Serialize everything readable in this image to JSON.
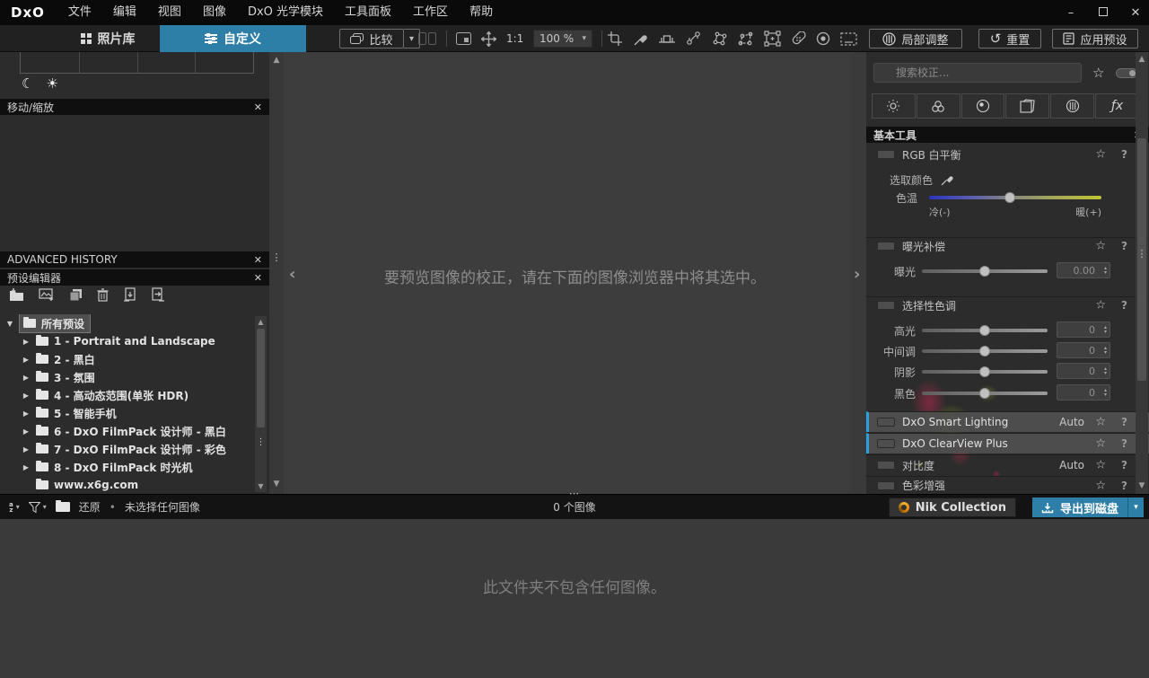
{
  "menubar": {
    "logo": "DxO",
    "items": [
      "文件",
      "编辑",
      "视图",
      "图像",
      "DxO 光学模块",
      "工具面板",
      "工作区",
      "帮助"
    ]
  },
  "toolbar": {
    "photo_library": "照片库",
    "customize": "自定义",
    "compare": "比较",
    "zoom_ratio": "1:1",
    "zoom_level": "100 %",
    "local_adjustments": "局部调整",
    "reset": "重置",
    "apply_preset": "应用预设"
  },
  "left_panel": {
    "move_zoom_title": "移动/缩放",
    "advanced_history_title": "ADVANCED HISTORY",
    "preset_editor_title": "预设编辑器",
    "tree": {
      "root": "所有预设",
      "items": [
        "1 - Portrait and Landscape",
        "2 - 黑白",
        "3 - 氛围",
        "4 - 高动态范围(单张 HDR)",
        "5 - 智能手机",
        "6 - DxO FilmPack 设计师 - 黑白",
        "7 - DxO FilmPack 设计师 - 彩色",
        "8 - DxO FilmPack 时光机",
        "www.x6g.com"
      ]
    }
  },
  "viewer": {
    "message": "要预览图像的校正，请在下面的图像浏览器中将其选中。"
  },
  "right_panel": {
    "search": {
      "placeholder": "搜索校正..."
    },
    "palette_title": "基本工具",
    "white_balance": {
      "label": "RGB 白平衡",
      "pick_color": "选取颜色",
      "temperature": "色温",
      "cold": "冷(-)",
      "warm": "暖(+)"
    },
    "exposure": {
      "label": "曝光补偿",
      "slider_label": "曝光",
      "value": "0.00"
    },
    "selective_tone": {
      "label": "选择性色调",
      "rows": [
        {
          "label": "高光",
          "value": "0"
        },
        {
          "label": "中间调",
          "value": "0"
        },
        {
          "label": "阴影",
          "value": "0"
        },
        {
          "label": "黑色",
          "value": "0"
        }
      ]
    },
    "tool_rows": [
      {
        "label": "DxO Smart Lighting",
        "mode": "Auto"
      },
      {
        "label": "DxO ClearView Plus",
        "mode": ""
      },
      {
        "label": "对比度",
        "mode": "Auto"
      },
      {
        "label": "色彩增强",
        "mode": ""
      }
    ],
    "fx_label": "ƒx"
  },
  "statusbar": {
    "restore": "还原",
    "separator": "•",
    "selection_status": "未选择任何图像",
    "image_count": "0 个图像",
    "nik_collection": "Nik Collection",
    "export_to_disk": "导出到磁盘"
  },
  "image_browser": {
    "empty_message": "此文件夹不包含任何图像。"
  },
  "icons": {
    "star": "☆",
    "help": "?",
    "close": "✕",
    "dropdown": "▾",
    "chevron_left": "‹",
    "chevron_right": "›",
    "tree_expanded": "▼",
    "tree_collapsed": "▶",
    "scroll_up": "▲",
    "scroll_down": "▼",
    "drag_dots": "⋮",
    "drag_ellipsis": "⋯",
    "moon": "☾",
    "sun": "☀",
    "reset_arrow": "↺",
    "minimize": "–",
    "bullet": "•",
    "stepper_up": "▴",
    "stepper_down": "▾"
  },
  "colors": {
    "accent_blue": "#2e7fa8",
    "highlight_row": "#4e4e4e",
    "smart_lighting_edge": "#2aa0dc",
    "nik_orange": "#f09a1e",
    "temp_cold": "#3039c8",
    "temp_warm": "#c0c433"
  }
}
